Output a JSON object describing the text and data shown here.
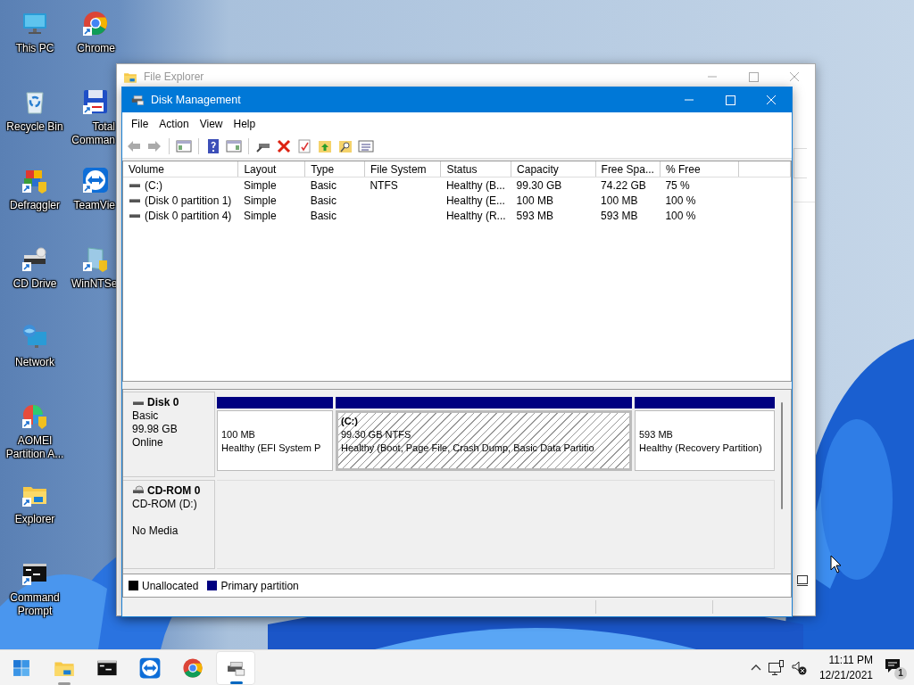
{
  "desktop_columns": [
    [
      {
        "label": "This PC",
        "kind": "computer",
        "shortcut": false
      },
      {
        "label": "Recycle Bin",
        "kind": "recycle",
        "shortcut": false
      },
      {
        "label": "Defraggler",
        "kind": "defraggler",
        "shortcut": true
      },
      {
        "label": "CD Drive",
        "kind": "cd",
        "shortcut": true
      },
      {
        "label": "Network",
        "kind": "network",
        "shortcut": false
      },
      {
        "label": "AOMEI Partition A...",
        "kind": "aomei",
        "shortcut": true
      },
      {
        "label": "Explorer",
        "kind": "folder",
        "shortcut": true
      },
      {
        "label": "Command Prompt",
        "kind": "cmd",
        "shortcut": true
      }
    ],
    [
      {
        "label": "Chrome",
        "kind": "chrome",
        "shortcut": true
      },
      {
        "label": "Total Comman",
        "kind": "commander",
        "shortcut": true
      },
      {
        "label": "TeamVie",
        "kind": "teamviewer",
        "shortcut": true
      },
      {
        "label": "WinNTSe",
        "kind": "winnt",
        "shortcut": true
      }
    ]
  ],
  "explorer_window": {
    "title": "File Explorer"
  },
  "disk_management": {
    "title": "Disk Management",
    "menu": [
      "File",
      "Action",
      "View",
      "Help"
    ],
    "volume_list": {
      "columns": [
        "Volume",
        "Layout",
        "Type",
        "File System",
        "Status",
        "Capacity",
        "Free Spa...",
        "% Free"
      ],
      "rows": [
        [
          "(C:)",
          "Simple",
          "Basic",
          "NTFS",
          "Healthy (B...",
          "99.30 GB",
          "74.22 GB",
          "75 %"
        ],
        [
          "(Disk 0 partition 1)",
          "Simple",
          "Basic",
          "",
          "Healthy (E...",
          "100 MB",
          "100 MB",
          "100 %"
        ],
        [
          "(Disk 0 partition 4)",
          "Simple",
          "Basic",
          "",
          "Healthy (R...",
          "593 MB",
          "593 MB",
          "100 %"
        ]
      ]
    },
    "disks": [
      {
        "kind": "disk",
        "name": "Disk 0",
        "type": "Basic",
        "size": "99.98 GB",
        "status": "Online",
        "partitions": [
          {
            "size": "100 MB",
            "status": "Healthy (EFI System P",
            "selected": false
          },
          {
            "label": "(C:)",
            "size": "99.30 GB NTFS",
            "status": "Healthy (Boot, Page File, Crash Dump, Basic Data Partitio",
            "selected": true
          },
          {
            "size": "593 MB",
            "status": "Healthy (Recovery Partition)",
            "selected": false
          }
        ]
      },
      {
        "kind": "cdrom",
        "name": "CD-ROM 0",
        "type": "CD-ROM (D:)",
        "status": "No Media"
      }
    ],
    "legend": [
      {
        "label": "Unallocated",
        "color": "#000000"
      },
      {
        "label": "Primary partition",
        "color": "#000080"
      }
    ]
  },
  "taskbar": {
    "items": [
      {
        "kind": "start",
        "open": false,
        "selected": false
      },
      {
        "kind": "folder",
        "open": true,
        "selected": false
      },
      {
        "kind": "cmd",
        "open": false,
        "selected": false
      },
      {
        "kind": "teamviewer",
        "open": false,
        "selected": false
      },
      {
        "kind": "chrome",
        "open": false,
        "selected": false
      },
      {
        "kind": "diskmgmt",
        "open": true,
        "selected": true
      }
    ],
    "time": "11:11 PM",
    "date": "12/21/2021",
    "notification_count": "1"
  }
}
